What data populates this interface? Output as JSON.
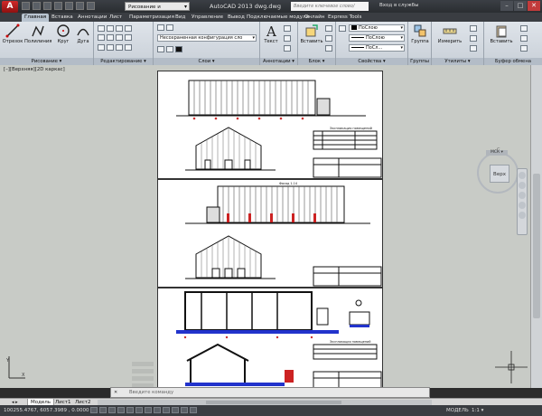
{
  "title": {
    "logo": "A",
    "workspace": "Рисование и аннотации",
    "app_title": "AutoCAD 2013   dwg.dwg",
    "search_placeholder": "Введите ключевое слово/фразу",
    "signin": "Вход в службы",
    "win_min": "–",
    "win_max": "□",
    "win_close": "✕"
  },
  "tabs": [
    "Главная",
    "Вставка",
    "Аннотации",
    "Лист",
    "Параметризация",
    "Вид",
    "Управление",
    "Вывод",
    "Подключаемые модули",
    "Онлайн",
    "Express Tools"
  ],
  "ribbon": {
    "draw": {
      "title": "Рисование ▾",
      "line": "Отрезок",
      "polyline": "Полилиния",
      "circle": "Круг",
      "arc": "Дуга"
    },
    "modify": {
      "title": "Редактирование ▾"
    },
    "layers": {
      "title": "Слои ▾",
      "combo": "Несохраненная конфигурация сло"
    },
    "annotation": {
      "title": "Аннотации ▾",
      "text": "Текст"
    },
    "block": {
      "title": "Блок ▾",
      "insert": "Вставить"
    },
    "properties": {
      "title": "Свойства ▾",
      "color": "ПоСлою",
      "linetype": "ПоСлою",
      "lineweight": "ПоСл..."
    },
    "groups": {
      "title": "Группы ▾",
      "group": "Группа"
    },
    "utilities": {
      "title": "Утилиты ▾",
      "measure": "Измерить"
    },
    "clipboard": {
      "title": "Буфер обмена",
      "paste": "Вставить"
    }
  },
  "viewport": {
    "label": "[–][Верхняя][2D каркас]",
    "navcube_face": "Верх",
    "compass_n": "С",
    "wcs": "МСК ▾"
  },
  "drawing_titles": {
    "table1": "Экспликация помещений",
    "sheet2_label": "Фасад 1-14",
    "sheet3_label": "Экспликация помещений"
  },
  "command_placeholder": "Введите команду",
  "layout_tabs": [
    "Модель",
    "Лист1",
    "Лист2"
  ],
  "status": {
    "coords": "100255.4767, 6057.3989 , 0.0000",
    "model": "МОДЕЛЬ",
    "scale": "1:1 ▾"
  }
}
